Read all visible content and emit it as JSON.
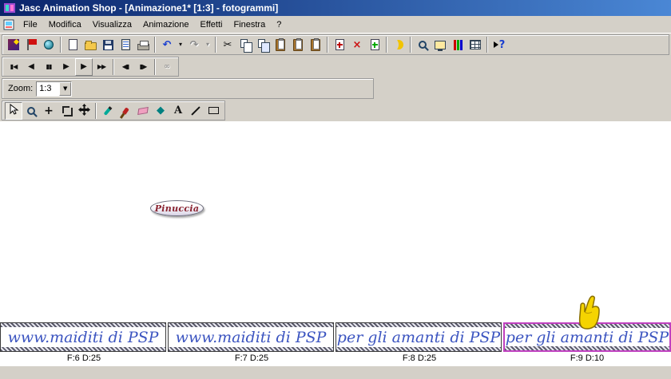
{
  "titlebar": {
    "title": "Jasc Animation Shop - [Animazione1* [1:3] - fotogrammi]"
  },
  "menubar": {
    "items": [
      "File",
      "Modifica",
      "Visualizza",
      "Animazione",
      "Effetti",
      "Finestra",
      "?"
    ]
  },
  "glyphs": {
    "undo": "↶",
    "redo": "↷",
    "dropdown": "▾",
    "cut": "✂",
    "delete": "×",
    "help": "?",
    "plus": "+",
    "fill": "◆",
    "text_tool": "A",
    "combo_arrow": "▼"
  },
  "vcr": {
    "buttons": [
      {
        "name": "go-to-first-frame",
        "glyph": "▮◀"
      },
      {
        "name": "step-back",
        "glyph": "◀"
      },
      {
        "name": "pause",
        "glyph": "▮▮"
      },
      {
        "name": "play",
        "glyph": "▶"
      },
      {
        "name": "play-animation",
        "glyph": "▶"
      },
      {
        "name": "fast-forward",
        "glyph": "▶▶"
      },
      {
        "name": "previous-frame",
        "glyph": "◀▮"
      },
      {
        "name": "next-frame",
        "glyph": "▮▶"
      },
      {
        "name": "loop",
        "glyph": "∞"
      }
    ]
  },
  "zoom": {
    "label": "Zoom:",
    "value": "1:3"
  },
  "workspace": {
    "badge_text": "Pinuccia"
  },
  "filmstrip": {
    "selected_index": 3,
    "frames": [
      {
        "text": "www.maiditi di PSP",
        "label": "F:6  D:25"
      },
      {
        "text": "www.maiditi di PSP",
        "label": "F:7  D:25"
      },
      {
        "text": "per gli amanti di PSP",
        "label": "F:8  D:25"
      },
      {
        "text": "per gli amanti di PSP",
        "label": "F:9  D:10"
      }
    ]
  },
  "colors": {
    "titlebar_left": "#0a246a",
    "titlebar_right": "#4a87d5",
    "chrome": "#d4d0c8",
    "frame_text": "#3b54c0",
    "selection_border": "#c040c0",
    "badge_text": "#8a2430"
  }
}
